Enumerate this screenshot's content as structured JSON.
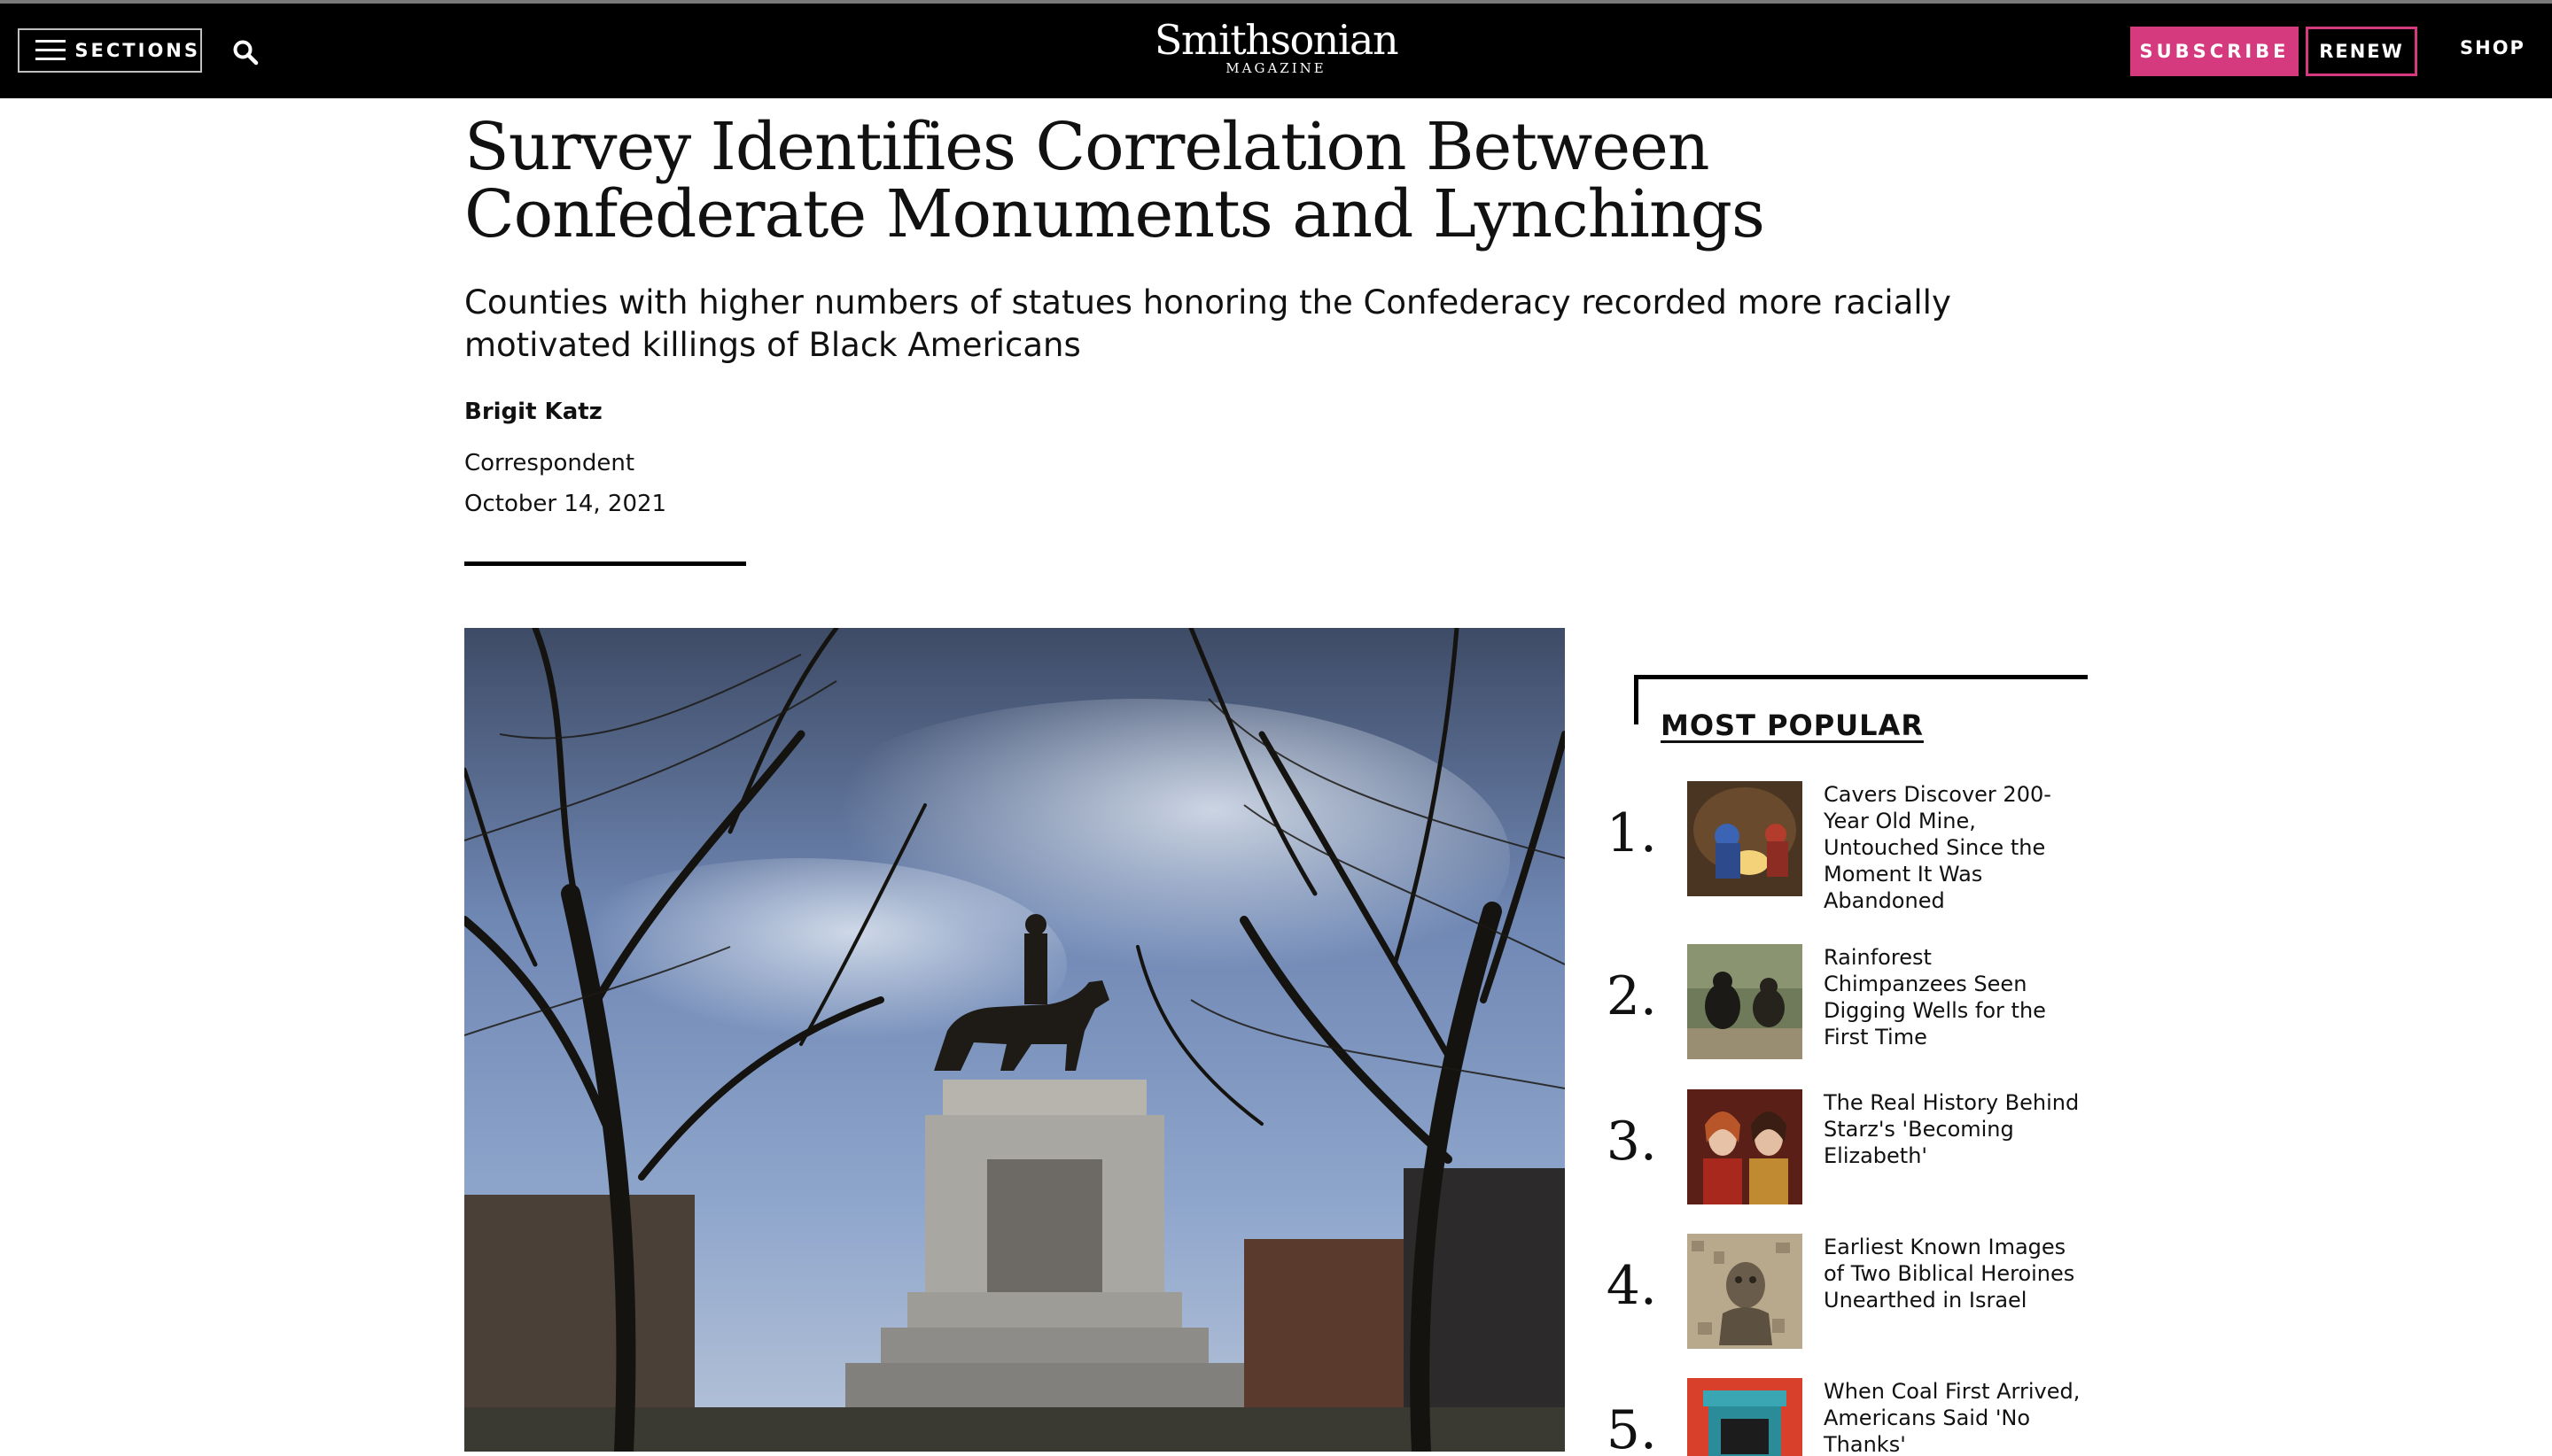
{
  "header": {
    "sections_label": "SECTIONS",
    "logo_main": "Smithsonian",
    "logo_sub": "MAGAZINE",
    "subscribe_label": "SUBSCRIBE",
    "renew_label": "RENEW",
    "shop_label": "SHOP"
  },
  "article": {
    "headline": "Survey Identifies Correlation Between Confederate Monuments and Lynchings",
    "dek": "Counties with higher numbers of statues honoring the Confederacy recorded more racially motivated killings of Black Americans",
    "author": "Brigit Katz",
    "role": "Correspondent",
    "date": "October 14, 2021"
  },
  "most_popular": {
    "title": "MOST POPULAR",
    "items": [
      {
        "rank": "1.",
        "title": "Cavers Discover 200-Year Old Mine, Untouched Since the Moment It Was Abandoned"
      },
      {
        "rank": "2.",
        "title": "Rainforest Chimpanzees Seen Digging Wells for the First Time"
      },
      {
        "rank": "3.",
        "title": "The Real History Behind Starz's 'Becoming Elizabeth'"
      },
      {
        "rank": "4.",
        "title": "Earliest Known Images of Two Biblical Heroines Unearthed in Israel"
      },
      {
        "rank": "5.",
        "title": "When Coal First Arrived, Americans Said 'No Thanks'"
      }
    ]
  },
  "colors": {
    "header_bg": "#000000",
    "accent": "#d53a7e"
  }
}
